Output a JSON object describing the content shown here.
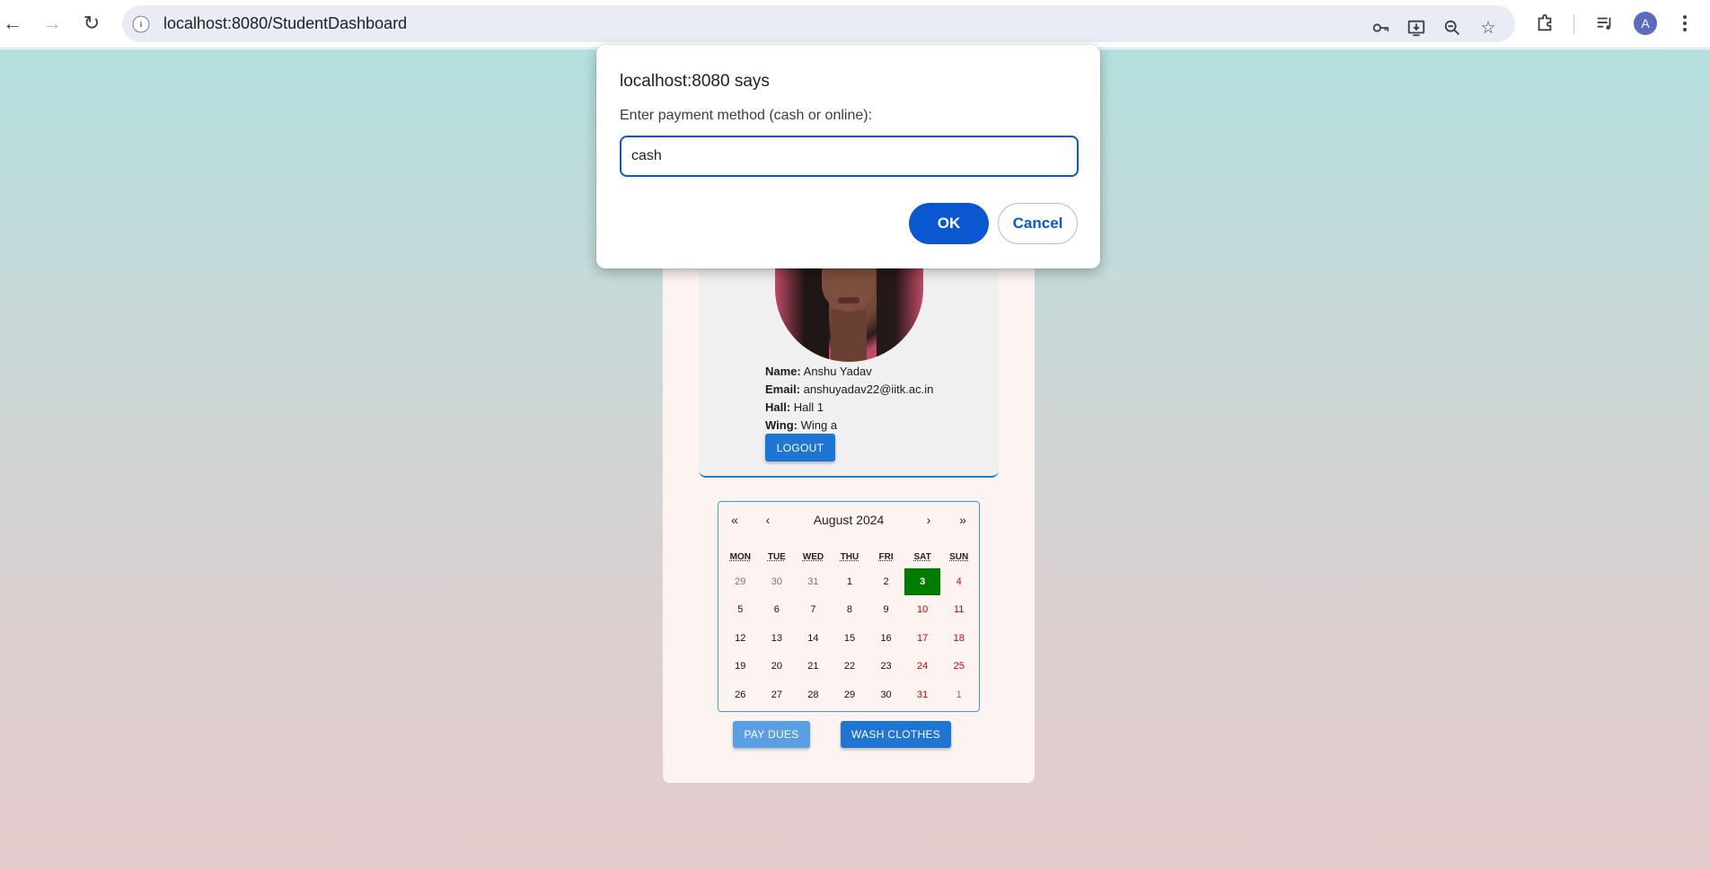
{
  "browser": {
    "url": "localhost:8080/StudentDashboard",
    "back_icon": "arrow-left-icon",
    "forward_icon": "arrow-right-icon",
    "reload_icon": "reload-icon",
    "profile_initial": "A"
  },
  "dialog": {
    "title": "localhost:8080 says",
    "message": "Enter payment method (cash or online):",
    "input_value": "cash",
    "ok_label": "OK",
    "cancel_label": "Cancel"
  },
  "profile": {
    "name_label": "Name:",
    "name_value": "Anshu Yadav",
    "email_label": "Email:",
    "email_value": "anshuyadav22@iitk.ac.in",
    "hall_label": "Hall:",
    "hall_value": "Hall 1",
    "wing_label": "Wing:",
    "wing_value": "Wing a",
    "logout_label": "LOGOUT"
  },
  "calendar": {
    "title": "August 2024",
    "prev_year": "«",
    "prev_month": "‹",
    "next_month": "›",
    "next_year": "»",
    "weekdays": [
      "MON",
      "TUE",
      "WED",
      "THU",
      "FRI",
      "SAT",
      "SUN"
    ],
    "days": [
      {
        "d": "29",
        "type": "other"
      },
      {
        "d": "30",
        "type": "other"
      },
      {
        "d": "31",
        "type": "other"
      },
      {
        "d": "1",
        "type": "normal"
      },
      {
        "d": "2",
        "type": "normal"
      },
      {
        "d": "3",
        "type": "today"
      },
      {
        "d": "4",
        "type": "weekend"
      },
      {
        "d": "5",
        "type": "normal"
      },
      {
        "d": "6",
        "type": "normal"
      },
      {
        "d": "7",
        "type": "normal"
      },
      {
        "d": "8",
        "type": "normal"
      },
      {
        "d": "9",
        "type": "normal"
      },
      {
        "d": "10",
        "type": "weekend"
      },
      {
        "d": "11",
        "type": "weekend"
      },
      {
        "d": "12",
        "type": "normal"
      },
      {
        "d": "13",
        "type": "normal"
      },
      {
        "d": "14",
        "type": "normal"
      },
      {
        "d": "15",
        "type": "normal"
      },
      {
        "d": "16",
        "type": "normal"
      },
      {
        "d": "17",
        "type": "weekend"
      },
      {
        "d": "18",
        "type": "weekend"
      },
      {
        "d": "19",
        "type": "normal"
      },
      {
        "d": "20",
        "type": "normal"
      },
      {
        "d": "21",
        "type": "normal"
      },
      {
        "d": "22",
        "type": "normal"
      },
      {
        "d": "23",
        "type": "normal"
      },
      {
        "d": "24",
        "type": "weekend"
      },
      {
        "d": "25",
        "type": "weekend"
      },
      {
        "d": "26",
        "type": "normal"
      },
      {
        "d": "27",
        "type": "normal"
      },
      {
        "d": "28",
        "type": "normal"
      },
      {
        "d": "29",
        "type": "normal"
      },
      {
        "d": "30",
        "type": "normal"
      },
      {
        "d": "31",
        "type": "weekend"
      },
      {
        "d": "1",
        "type": "other"
      }
    ]
  },
  "actions": {
    "pay_dues_label": "PAY DUES",
    "wash_clothes_label": "WASH CLOTHES"
  },
  "colors": {
    "accent": "#1e76d2",
    "dialog_primary": "#0b57d0",
    "today": "#007c00",
    "weekend": "#d10000"
  }
}
